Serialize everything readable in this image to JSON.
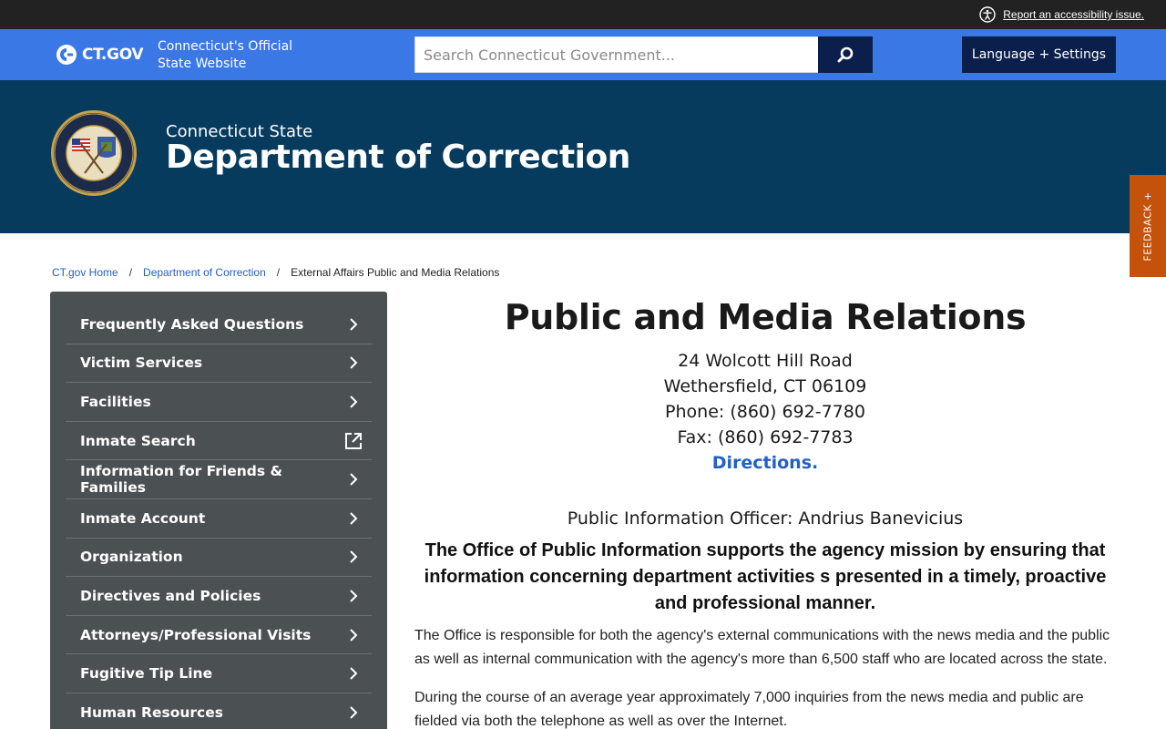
{
  "topbar": {
    "accessibility_link": "Report an accessibility issue."
  },
  "ctbar": {
    "logo_text": "CT.GOV",
    "tagline_line1": "Connecticut's Official",
    "tagline_line2": "State Website",
    "search_placeholder": "Search Connecticut Government...",
    "language_button": "Language + Settings"
  },
  "agency": {
    "subtitle": "Connecticut State",
    "title": "Department of Correction"
  },
  "feedback": {
    "label": "FEEDBACK +"
  },
  "breadcrumb": {
    "items": [
      "CT.gov Home",
      "Department of Correction"
    ],
    "current": "External Affairs Public and Media Relations"
  },
  "sidebar": {
    "items": [
      {
        "label": "Frequently Asked Questions",
        "icon": "chevron-right-icon"
      },
      {
        "label": "Victim Services",
        "icon": "chevron-right-icon"
      },
      {
        "label": "Facilities",
        "icon": "chevron-right-icon"
      },
      {
        "label": "Inmate Search",
        "icon": "external-link-icon"
      },
      {
        "label": "Information for Friends & Families",
        "icon": "chevron-right-icon"
      },
      {
        "label": "Inmate Account",
        "icon": "chevron-right-icon"
      },
      {
        "label": "Organization",
        "icon": "chevron-right-icon"
      },
      {
        "label": "Directives and Policies",
        "icon": "chevron-right-icon"
      },
      {
        "label": "Attorneys/Professional Visits",
        "icon": "chevron-right-icon"
      },
      {
        "label": "Fugitive Tip Line",
        "icon": "chevron-right-icon"
      },
      {
        "label": "Human Resources",
        "icon": "chevron-right-icon"
      }
    ]
  },
  "main": {
    "title": "Public and Media Relations",
    "address": {
      "street": "24 Wolcott Hill Road",
      "city": "Wethersfield, CT 06109",
      "phone": "Phone: (860) 692-7780",
      "fax": "Fax: (860) 692-7783",
      "directions": "Directions."
    },
    "pio": "Public Information Officer:  Andrius Banevicius",
    "mission": "The Office of Public Information supports the agency mission by ensuring that information concerning department activities s presented in a timely, proactive and professional manner.",
    "paragraphs": [
      "The Office is responsible for both the agency's external communications with the news media and the public as well as internal communication with the agency's more than 6,500 staff who are located across the state.",
      "During the course of an average year approximately 7,000 inquiries from the news media and public are fielded via both the telephone as well as over the Internet."
    ]
  },
  "colors": {
    "ct_bar": "#3a78e6",
    "navy": "#0b1f4c",
    "agency_banner": "#073b5e",
    "sidebar_bg": "#4b5052",
    "link": "#2260c9",
    "feedback": "#c4520b"
  }
}
